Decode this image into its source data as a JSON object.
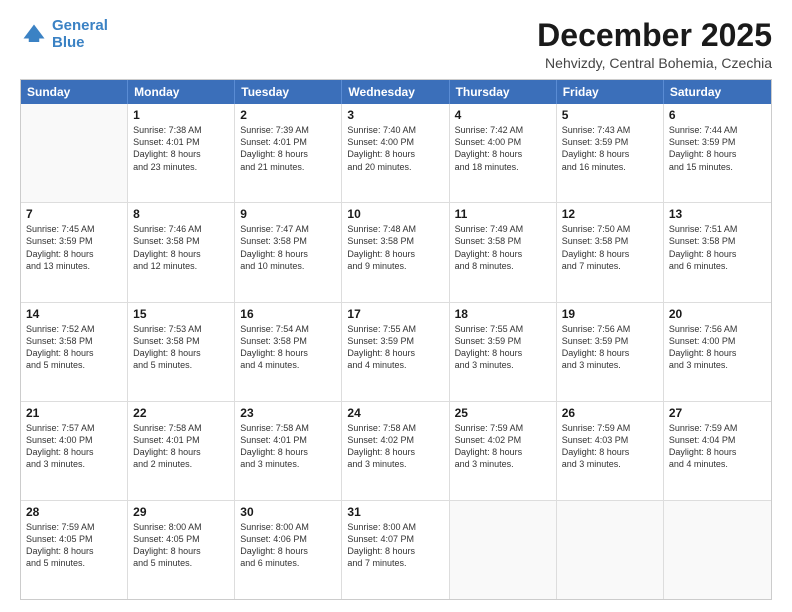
{
  "logo": {
    "line1": "General",
    "line2": "Blue"
  },
  "title": "December 2025",
  "subtitle": "Nehvizdy, Central Bohemia, Czechia",
  "header_days": [
    "Sunday",
    "Monday",
    "Tuesday",
    "Wednesday",
    "Thursday",
    "Friday",
    "Saturday"
  ],
  "weeks": [
    [
      {
        "day": "",
        "text": ""
      },
      {
        "day": "1",
        "text": "Sunrise: 7:38 AM\nSunset: 4:01 PM\nDaylight: 8 hours\nand 23 minutes."
      },
      {
        "day": "2",
        "text": "Sunrise: 7:39 AM\nSunset: 4:01 PM\nDaylight: 8 hours\nand 21 minutes."
      },
      {
        "day": "3",
        "text": "Sunrise: 7:40 AM\nSunset: 4:00 PM\nDaylight: 8 hours\nand 20 minutes."
      },
      {
        "day": "4",
        "text": "Sunrise: 7:42 AM\nSunset: 4:00 PM\nDaylight: 8 hours\nand 18 minutes."
      },
      {
        "day": "5",
        "text": "Sunrise: 7:43 AM\nSunset: 3:59 PM\nDaylight: 8 hours\nand 16 minutes."
      },
      {
        "day": "6",
        "text": "Sunrise: 7:44 AM\nSunset: 3:59 PM\nDaylight: 8 hours\nand 15 minutes."
      }
    ],
    [
      {
        "day": "7",
        "text": "Sunrise: 7:45 AM\nSunset: 3:59 PM\nDaylight: 8 hours\nand 13 minutes."
      },
      {
        "day": "8",
        "text": "Sunrise: 7:46 AM\nSunset: 3:58 PM\nDaylight: 8 hours\nand 12 minutes."
      },
      {
        "day": "9",
        "text": "Sunrise: 7:47 AM\nSunset: 3:58 PM\nDaylight: 8 hours\nand 10 minutes."
      },
      {
        "day": "10",
        "text": "Sunrise: 7:48 AM\nSunset: 3:58 PM\nDaylight: 8 hours\nand 9 minutes."
      },
      {
        "day": "11",
        "text": "Sunrise: 7:49 AM\nSunset: 3:58 PM\nDaylight: 8 hours\nand 8 minutes."
      },
      {
        "day": "12",
        "text": "Sunrise: 7:50 AM\nSunset: 3:58 PM\nDaylight: 8 hours\nand 7 minutes."
      },
      {
        "day": "13",
        "text": "Sunrise: 7:51 AM\nSunset: 3:58 PM\nDaylight: 8 hours\nand 6 minutes."
      }
    ],
    [
      {
        "day": "14",
        "text": "Sunrise: 7:52 AM\nSunset: 3:58 PM\nDaylight: 8 hours\nand 5 minutes."
      },
      {
        "day": "15",
        "text": "Sunrise: 7:53 AM\nSunset: 3:58 PM\nDaylight: 8 hours\nand 5 minutes."
      },
      {
        "day": "16",
        "text": "Sunrise: 7:54 AM\nSunset: 3:58 PM\nDaylight: 8 hours\nand 4 minutes."
      },
      {
        "day": "17",
        "text": "Sunrise: 7:55 AM\nSunset: 3:59 PM\nDaylight: 8 hours\nand 4 minutes."
      },
      {
        "day": "18",
        "text": "Sunrise: 7:55 AM\nSunset: 3:59 PM\nDaylight: 8 hours\nand 3 minutes."
      },
      {
        "day": "19",
        "text": "Sunrise: 7:56 AM\nSunset: 3:59 PM\nDaylight: 8 hours\nand 3 minutes."
      },
      {
        "day": "20",
        "text": "Sunrise: 7:56 AM\nSunset: 4:00 PM\nDaylight: 8 hours\nand 3 minutes."
      }
    ],
    [
      {
        "day": "21",
        "text": "Sunrise: 7:57 AM\nSunset: 4:00 PM\nDaylight: 8 hours\nand 3 minutes."
      },
      {
        "day": "22",
        "text": "Sunrise: 7:58 AM\nSunset: 4:01 PM\nDaylight: 8 hours\nand 2 minutes."
      },
      {
        "day": "23",
        "text": "Sunrise: 7:58 AM\nSunset: 4:01 PM\nDaylight: 8 hours\nand 3 minutes."
      },
      {
        "day": "24",
        "text": "Sunrise: 7:58 AM\nSunset: 4:02 PM\nDaylight: 8 hours\nand 3 minutes."
      },
      {
        "day": "25",
        "text": "Sunrise: 7:59 AM\nSunset: 4:02 PM\nDaylight: 8 hours\nand 3 minutes."
      },
      {
        "day": "26",
        "text": "Sunrise: 7:59 AM\nSunset: 4:03 PM\nDaylight: 8 hours\nand 3 minutes."
      },
      {
        "day": "27",
        "text": "Sunrise: 7:59 AM\nSunset: 4:04 PM\nDaylight: 8 hours\nand 4 minutes."
      }
    ],
    [
      {
        "day": "28",
        "text": "Sunrise: 7:59 AM\nSunset: 4:05 PM\nDaylight: 8 hours\nand 5 minutes."
      },
      {
        "day": "29",
        "text": "Sunrise: 8:00 AM\nSunset: 4:05 PM\nDaylight: 8 hours\nand 5 minutes."
      },
      {
        "day": "30",
        "text": "Sunrise: 8:00 AM\nSunset: 4:06 PM\nDaylight: 8 hours\nand 6 minutes."
      },
      {
        "day": "31",
        "text": "Sunrise: 8:00 AM\nSunset: 4:07 PM\nDaylight: 8 hours\nand 7 minutes."
      },
      {
        "day": "",
        "text": ""
      },
      {
        "day": "",
        "text": ""
      },
      {
        "day": "",
        "text": ""
      }
    ]
  ]
}
